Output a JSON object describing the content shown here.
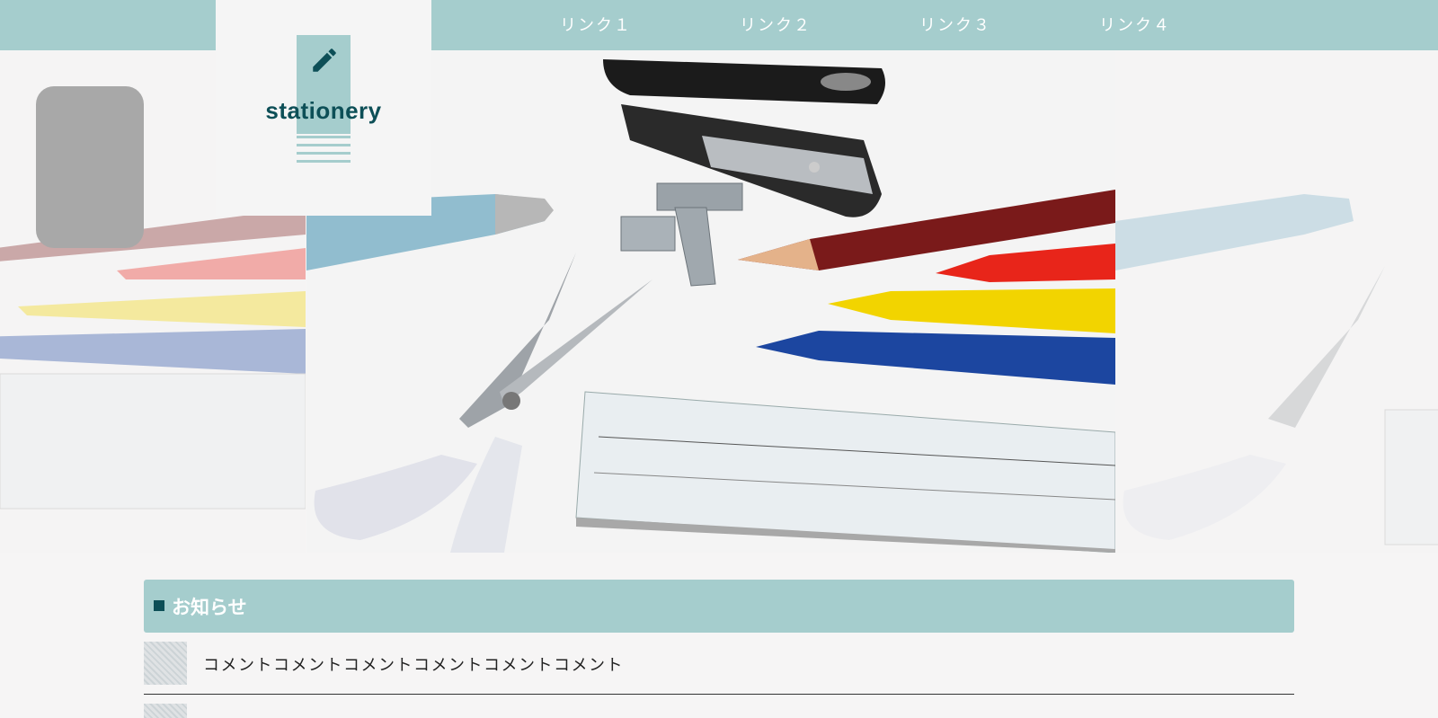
{
  "brand": {
    "name": "stationery",
    "icon": "pencil-icon"
  },
  "nav": {
    "links": [
      "リンク１",
      "リンク２",
      "リンク３",
      "リンク４"
    ]
  },
  "notices": {
    "title": "お知らせ",
    "items": [
      {
        "text": "コメントコメントコメントコメントコメントコメント"
      },
      {
        "text": ""
      }
    ]
  },
  "colors": {
    "accent": "#a5cdcd",
    "brand_dark": "#0d4f57",
    "background": "#f6f5f5"
  },
  "hero": {
    "image": "stationery-photo"
  }
}
